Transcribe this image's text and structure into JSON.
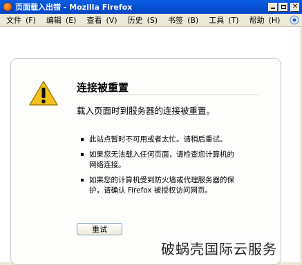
{
  "window": {
    "title": "页面载入出错 - Mozilla Firefox",
    "app_icon": "firefox-icon"
  },
  "menubar": {
    "items": [
      {
        "label": "文件",
        "accel": "(F)"
      },
      {
        "label": "编辑",
        "accel": "(E)"
      },
      {
        "label": "查看",
        "accel": "(V)"
      },
      {
        "label": "历史",
        "accel": "(S)"
      },
      {
        "label": "书签",
        "accel": "(B)"
      },
      {
        "label": "工具",
        "accel": "(T)"
      },
      {
        "label": "帮助",
        "accel": "(H)"
      }
    ],
    "throbber_icon": "throbber-icon"
  },
  "error": {
    "icon": "warning-icon",
    "title": "连接被重置",
    "description": "载入页面时到服务器的连接被重置。",
    "bullets": [
      "此站点暂时不可用或者太忙。请稍后重试。",
      "如果您无法载入任何页面，请检查您计算机的网络连接。",
      "如果您的计算机受到防火墙或代理服务器的保护，请确认 Firefox 被授权访问网页。"
    ],
    "retry_label": "重试"
  },
  "watermark": "破蜗壳国际云服务",
  "colors": {
    "titlebar": "#0551d4",
    "chrome": "#ece9d8",
    "warning_yellow": "#f4c21b"
  }
}
